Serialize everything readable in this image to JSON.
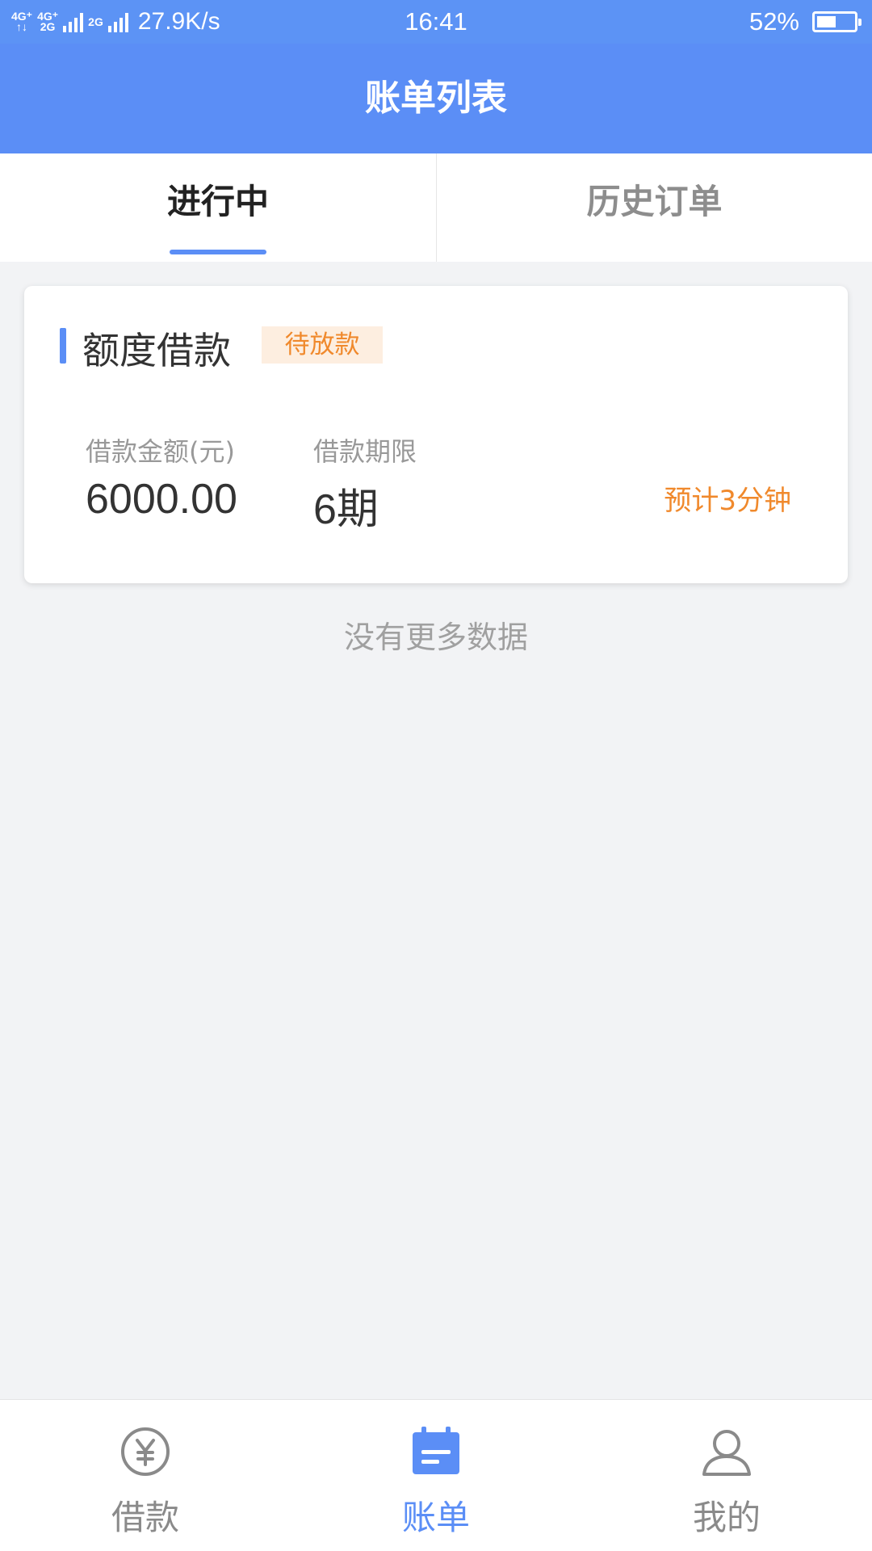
{
  "status_bar": {
    "network_badges": [
      [
        "4G⁺",
        "↑↓"
      ],
      [
        "4G⁺",
        "2G"
      ],
      [
        "2G",
        ""
      ]
    ],
    "speed": "27.9K/s",
    "time": "16:41",
    "battery_percent_text": "52%",
    "battery_level": 0.52
  },
  "nav": {
    "title": "账单列表"
  },
  "tabs": [
    {
      "label": "进行中",
      "active": true
    },
    {
      "label": "历史订单",
      "active": false
    }
  ],
  "card": {
    "title": "额度借款",
    "status": "待放款",
    "amount_label": "借款金额(元)",
    "amount_value": "6000.00",
    "term_label": "借款期限",
    "term_value": "6期",
    "eta": "预计3分钟"
  },
  "list_footer": "没有更多数据",
  "bottom_nav": [
    {
      "label": "借款",
      "icon": "yuan-circle-icon",
      "active": false
    },
    {
      "label": "账单",
      "icon": "calendar-bill-icon",
      "active": true
    },
    {
      "label": "我的",
      "icon": "user-icon",
      "active": false
    }
  ],
  "colors": {
    "primary": "#5b8ef6",
    "accent_orange": "#f0892c",
    "badge_bg": "#fdeee0",
    "page_bg": "#f2f3f5"
  }
}
